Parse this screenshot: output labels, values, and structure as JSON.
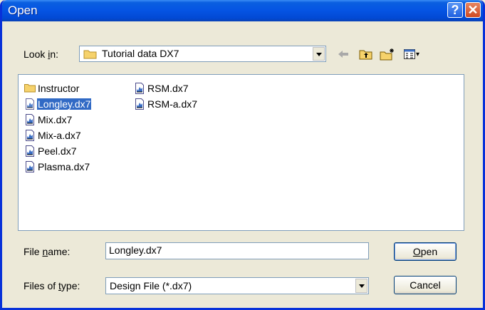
{
  "window": {
    "title": "Open",
    "help_label": "?",
    "close_label": "✕"
  },
  "lookin": {
    "label_pre": "Look ",
    "label_key": "i",
    "label_post": "n:",
    "value": "Tutorial data DX7"
  },
  "toolbar": {
    "icons": [
      "back-arrow-icon",
      "up-one-level-icon",
      "new-folder-icon",
      "views-menu-icon"
    ],
    "views_dropdown": "▾"
  },
  "files": {
    "column1": [
      {
        "name": "Instructor",
        "type": "folder"
      },
      {
        "name": "Longley.dx7",
        "type": "file",
        "selected": true
      },
      {
        "name": "Mix.dx7",
        "type": "file"
      },
      {
        "name": "Mix-a.dx7",
        "type": "file"
      },
      {
        "name": "Peel.dx7",
        "type": "file"
      },
      {
        "name": "Plasma.dx7",
        "type": "file"
      }
    ],
    "column2": [
      {
        "name": "RSM.dx7",
        "type": "file"
      },
      {
        "name": "RSM-a.dx7",
        "type": "file"
      }
    ]
  },
  "filename": {
    "label_pre": "File ",
    "label_key": "n",
    "label_post": "ame:",
    "value": "Longley.dx7"
  },
  "filetype": {
    "label_pre": "Files of ",
    "label_key": "t",
    "label_post": "ype:",
    "value": "Design File (*.dx7)"
  },
  "buttons": {
    "open_key": "O",
    "open_rest": "pen",
    "cancel": "Cancel"
  },
  "colors": {
    "titlebar": "#0554e3",
    "selection": "#316ac5",
    "face": "#ece9d8"
  }
}
